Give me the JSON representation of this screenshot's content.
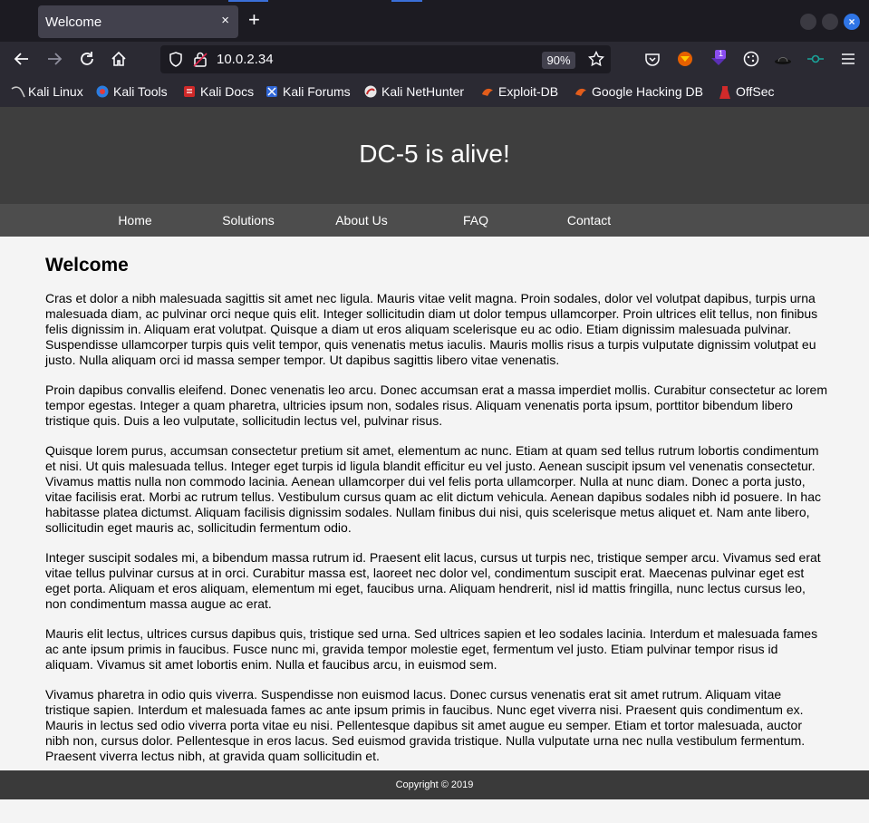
{
  "browser": {
    "tab_title": "Welcome",
    "tab_close": "×",
    "new_tab": "+",
    "window_close": "×",
    "url": "10.0.2.34",
    "zoom": "90%",
    "bookmarks": [
      {
        "label": "Kali Linux",
        "icon": "kali-dragon-icon"
      },
      {
        "label": "Kali Tools",
        "icon": "kali-tools-icon"
      },
      {
        "label": "Kali Docs",
        "icon": "kali-docs-icon"
      },
      {
        "label": "Kali Forums",
        "icon": "kali-forums-icon"
      },
      {
        "label": "Kali NetHunter",
        "icon": "nethunter-icon"
      },
      {
        "label": "Exploit-DB",
        "icon": "exploit-db-icon"
      },
      {
        "label": "Google Hacking DB",
        "icon": "ghdb-icon"
      },
      {
        "label": "OffSec",
        "icon": "offsec-icon"
      }
    ],
    "extension_badge": "1"
  },
  "site": {
    "title": "DC-5 is alive!",
    "menu": [
      "Home",
      "Solutions",
      "About Us",
      "FAQ",
      "Contact"
    ],
    "heading": "Welcome",
    "paragraphs": [
      "Cras et dolor a nibh malesuada sagittis sit amet nec ligula. Mauris vitae velit magna. Proin sodales, dolor vel volutpat dapibus, turpis urna malesuada diam, ac pulvinar orci neque quis elit. Integer sollicitudin diam ut dolor tempus ullamcorper. Proin ultrices elit tellus, non finibus felis dignissim in. Aliquam erat volutpat. Quisque a diam ut eros aliquam scelerisque eu ac odio. Etiam dignissim malesuada pulvinar. Suspendisse ullamcorper turpis quis velit tempor, quis venenatis metus iaculis. Mauris mollis risus a turpis vulputate dignissim volutpat eu justo. Nulla aliquam orci id massa semper tempor. Ut dapibus sagittis libero vitae venenatis.",
      "Proin dapibus convallis eleifend. Donec venenatis leo arcu. Donec accumsan erat a massa imperdiet mollis. Curabitur consectetur ac lorem tempor egestas. Integer a quam pharetra, ultricies ipsum non, sodales risus. Aliquam venenatis porta ipsum, porttitor bibendum libero tristique quis. Duis a leo vulputate, sollicitudin lectus vel, pulvinar risus.",
      "Quisque lorem purus, accumsan consectetur pretium sit amet, elementum ac nunc. Etiam at quam sed tellus rutrum lobortis condimentum et nisi. Ut quis malesuada tellus. Integer eget turpis id ligula blandit efficitur eu vel justo. Aenean suscipit ipsum vel venenatis consectetur. Vivamus mattis nulla non commodo lacinia. Aenean ullamcorper dui vel felis porta ullamcorper. Nulla at nunc diam. Donec a porta justo, vitae facilisis erat. Morbi ac rutrum tellus. Vestibulum cursus quam ac elit dictum vehicula. Aenean dapibus sodales nibh id posuere. In hac habitasse platea dictumst. Aliquam facilisis dignissim sodales. Nullam finibus dui nisi, quis scelerisque metus aliquet et. Nam ante libero, sollicitudin eget mauris ac, sollicitudin fermentum odio.",
      "Integer suscipit sodales mi, a bibendum massa rutrum id. Praesent elit lacus, cursus ut turpis nec, tristique semper arcu. Vivamus sed erat vitae tellus pulvinar cursus at in orci. Curabitur massa est, laoreet nec dolor vel, condimentum suscipit erat. Maecenas pulvinar eget est eget porta. Aliquam et eros aliquam, elementum mi eget, faucibus urna. Aliquam hendrerit, nisl id mattis fringilla, nunc lectus cursus leo, non condimentum massa augue ac erat.",
      "Mauris elit lectus, ultrices cursus dapibus quis, tristique sed urna. Sed ultrices sapien et leo sodales lacinia. Interdum et malesuada fames ac ante ipsum primis in faucibus. Fusce nunc mi, gravida tempor molestie eget, fermentum vel justo. Etiam pulvinar tempor risus id aliquam. Vivamus sit amet lobortis enim. Nulla et faucibus arcu, in euismod sem.",
      "Vivamus pharetra in odio quis viverra. Suspendisse non euismod lacus. Donec cursus venenatis erat sit amet rutrum. Aliquam vitae tristique sapien. Interdum et malesuada fames ac ante ipsum primis in faucibus. Nunc eget viverra nisi. Praesent quis condimentum ex. Mauris in lectus sed odio viverra porta vitae eu nisi. Pellentesque dapibus sit amet augue eu semper. Etiam et tortor malesuada, auctor nibh non, cursus dolor. Pellentesque in eros lacus. Sed euismod gravida tristique. Nulla vulputate urna nec nulla vestibulum fermentum. Praesent viverra lectus nibh, at gravida quam sollicitudin et."
    ],
    "footer": "Copyright © 2019"
  }
}
